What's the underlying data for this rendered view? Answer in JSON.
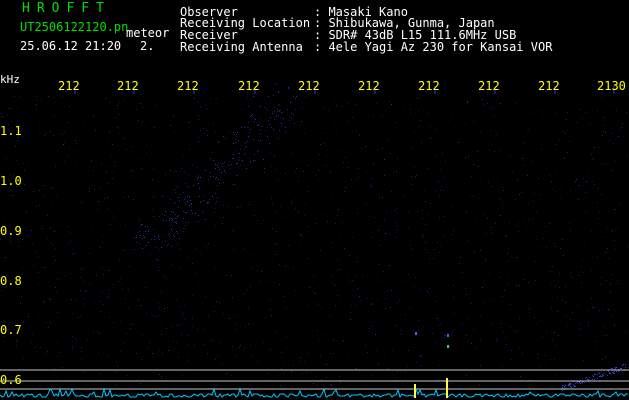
{
  "header": {
    "brand": "HROFFT",
    "filename": "UT2506122120.pn",
    "mode": "meteor",
    "datetime": "25.06.12 21:20",
    "counter": "2.",
    "info_rows": [
      {
        "label": "Observer",
        "value": ": Masaki Kano"
      },
      {
        "label": "Receiving Location",
        "value": ": Shibukawa, Gunma, Japan"
      },
      {
        "label": "Receiver",
        "value": ": SDR# 43dB L15 111.6MHz USB"
      },
      {
        "label": "Receiving Antenna",
        "value": ": 4ele Yagi Az 230 for Kansai VOR"
      }
    ]
  },
  "axis": {
    "unit": "kHz",
    "time_ticks": [
      "212",
      "212",
      "212",
      "212",
      "212",
      "212",
      "212",
      "212",
      "212",
      "2130"
    ],
    "freq_ticks": [
      "1.1",
      "1.0",
      "0.9",
      "0.8",
      "0.7",
      "0.6"
    ]
  },
  "colors": {
    "background": "#000000",
    "header_text": "#ffffff",
    "brand": "#00e000",
    "tick_text": "#ffff00",
    "signal_dots": "#1a2aa8",
    "baseline": "#00c8ff",
    "guide_lines": "#c8c8c8",
    "spike": "#ffff40"
  }
}
